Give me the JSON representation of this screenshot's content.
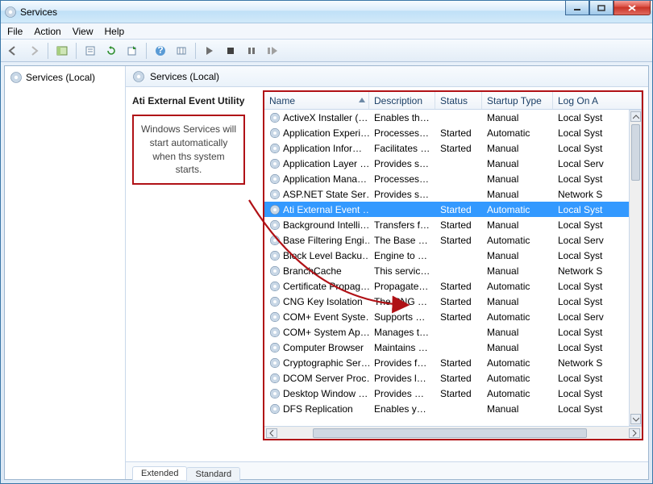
{
  "window": {
    "title": "Services"
  },
  "menubar": [
    "File",
    "Action",
    "View",
    "Help"
  ],
  "tree": {
    "root": "Services (Local)"
  },
  "right_header": "Services (Local)",
  "detail": {
    "title": "Ati External Event Utility"
  },
  "callout": {
    "text": "Windows Services will start automatically when ths system starts."
  },
  "columns": {
    "name": "Name",
    "description": "Description",
    "status": "Status",
    "startup": "Startup Type",
    "logon": "Log On A"
  },
  "tabs": {
    "extended": "Extended",
    "standard": "Standard"
  },
  "services": [
    {
      "name": "ActiveX Installer (…",
      "desc": "Enables the …",
      "status": "",
      "startup": "Manual",
      "logon": "Local Syst"
    },
    {
      "name": "Application Experi…",
      "desc": "Processes a…",
      "status": "Started",
      "startup": "Automatic",
      "logon": "Local Syst"
    },
    {
      "name": "Application Infor…",
      "desc": "Facilitates t…",
      "status": "Started",
      "startup": "Manual",
      "logon": "Local Syst"
    },
    {
      "name": "Application Layer …",
      "desc": "Provides su…",
      "status": "",
      "startup": "Manual",
      "logon": "Local Serv"
    },
    {
      "name": "Application Mana…",
      "desc": "Processes in…",
      "status": "",
      "startup": "Manual",
      "logon": "Local Syst"
    },
    {
      "name": "ASP.NET State Ser…",
      "desc": "Provides su…",
      "status": "",
      "startup": "Manual",
      "logon": "Network S"
    },
    {
      "name": "Ati External Event …",
      "desc": "",
      "status": "Started",
      "startup": "Automatic",
      "logon": "Local Syst",
      "selected": true
    },
    {
      "name": "Background Intelli…",
      "desc": "Transfers fil…",
      "status": "Started",
      "startup": "Manual",
      "logon": "Local Syst"
    },
    {
      "name": "Base Filtering Engi…",
      "desc": "The Base Fil…",
      "status": "Started",
      "startup": "Automatic",
      "logon": "Local Serv"
    },
    {
      "name": "Block Level Backu…",
      "desc": "Engine to p…",
      "status": "",
      "startup": "Manual",
      "logon": "Local Syst"
    },
    {
      "name": "BranchCache",
      "desc": "This service …",
      "status": "",
      "startup": "Manual",
      "logon": "Network S"
    },
    {
      "name": "Certificate Propag…",
      "desc": "Propagates …",
      "status": "Started",
      "startup": "Automatic",
      "logon": "Local Syst"
    },
    {
      "name": "CNG Key Isolation",
      "desc": "The CNG ke…",
      "status": "Started",
      "startup": "Manual",
      "logon": "Local Syst"
    },
    {
      "name": "COM+ Event Syste…",
      "desc": "Supports Sy…",
      "status": "Started",
      "startup": "Automatic",
      "logon": "Local Serv"
    },
    {
      "name": "COM+ System Ap…",
      "desc": "Manages th…",
      "status": "",
      "startup": "Manual",
      "logon": "Local Syst"
    },
    {
      "name": "Computer Browser",
      "desc": "Maintains a…",
      "status": "",
      "startup": "Manual",
      "logon": "Local Syst"
    },
    {
      "name": "Cryptographic Ser…",
      "desc": "Provides fo…",
      "status": "Started",
      "startup": "Automatic",
      "logon": "Network S"
    },
    {
      "name": "DCOM Server Proc…",
      "desc": "Provides lau…",
      "status": "Started",
      "startup": "Automatic",
      "logon": "Local Syst"
    },
    {
      "name": "Desktop Window …",
      "desc": "Provides De…",
      "status": "Started",
      "startup": "Automatic",
      "logon": "Local Syst"
    },
    {
      "name": "DFS Replication",
      "desc": "Enables you…",
      "status": "",
      "startup": "Manual",
      "logon": "Local Syst"
    }
  ]
}
